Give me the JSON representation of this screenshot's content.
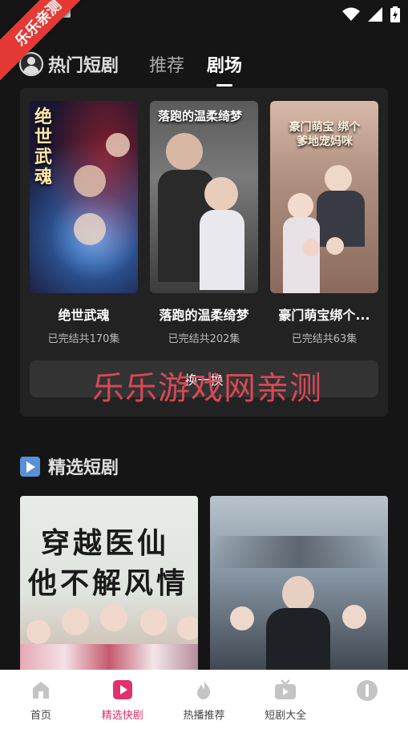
{
  "ribbon": {
    "text": "乐乐亲测"
  },
  "header": {
    "hot_title": "热门短剧",
    "tabs": [
      {
        "label": "推荐",
        "active": false
      },
      {
        "label": "剧场",
        "active": true
      }
    ]
  },
  "hot_dramas": [
    {
      "title": "绝世武魂",
      "status": "已完结共170集",
      "poster_text": "绝世武魂"
    },
    {
      "title": "落跑的温柔绮梦",
      "status": "已完结共202集",
      "poster_text": "落跑的温柔绮梦"
    },
    {
      "title": "豪门萌宝绑个...",
      "status": "已完结共63集",
      "poster_text": "豪门萌宝 绑个爹地宠妈咪"
    }
  ],
  "refresh_button": {
    "label": "换一换"
  },
  "watermark": {
    "text": "乐乐游戏网亲测"
  },
  "selected_section": {
    "title": "精选短剧",
    "posters": [
      {
        "poster_text_line1": "穿越医仙",
        "poster_text_line2": "他不解风情"
      },
      {
        "poster_text_line1": "",
        "poster_text_line2": ""
      }
    ]
  },
  "bottom_nav": [
    {
      "label": "首页",
      "icon": "home-icon",
      "active": false
    },
    {
      "label": "精选快剧",
      "icon": "play-icon",
      "active": true
    },
    {
      "label": "热播推荐",
      "icon": "flame-icon",
      "active": false
    },
    {
      "label": "短剧大全",
      "icon": "tv-icon",
      "active": false
    },
    {
      "label": "",
      "icon": "profile-icon",
      "active": false
    }
  ],
  "colors": {
    "accent": "#e0306e",
    "watermark": "#e84a58",
    "panel": "#222222",
    "background": "#151515"
  }
}
